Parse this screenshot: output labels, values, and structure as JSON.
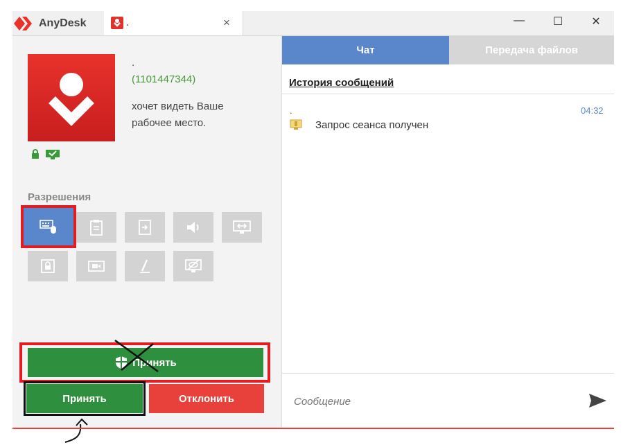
{
  "titlebar": {
    "app_name": "AnyDesk",
    "session_tab_title": ".",
    "close_tab": "×",
    "minimize": "—",
    "maximize": "☐",
    "close": "✕"
  },
  "request": {
    "peer_name": ".",
    "peer_id": "(1101447344)",
    "message": "хочет видеть Ваше рабочее место."
  },
  "permissions": {
    "title": "Разрешения",
    "items": [
      {
        "icon": "keyboard-mouse-icon",
        "active": true
      },
      {
        "icon": "clipboard-icon",
        "active": false
      },
      {
        "icon": "file-transfer-icon",
        "active": false
      },
      {
        "icon": "sound-icon",
        "active": false
      },
      {
        "icon": "control-screen-icon",
        "active": false
      },
      {
        "icon": "lock-screen-icon",
        "active": false
      },
      {
        "icon": "record-icon",
        "active": false
      },
      {
        "icon": "draw-icon",
        "active": false
      },
      {
        "icon": "privacy-icon",
        "active": false
      }
    ]
  },
  "buttons": {
    "accept_big": "Принять",
    "accept": "Принять",
    "decline": "Отклонить"
  },
  "tabs": {
    "chat": "Чат",
    "files": "Передача файлов"
  },
  "chat": {
    "history_title": "История сообщений",
    "message": {
      "sender": ".",
      "time": "04:32",
      "text": "Запрос сеанса получен"
    },
    "compose_placeholder": "Сообщение"
  },
  "colors": {
    "brand_red": "#e8322b",
    "accent_blue": "#5a86cc",
    "accept_green": "#2e8f3e",
    "decline_red": "#e8413b"
  }
}
